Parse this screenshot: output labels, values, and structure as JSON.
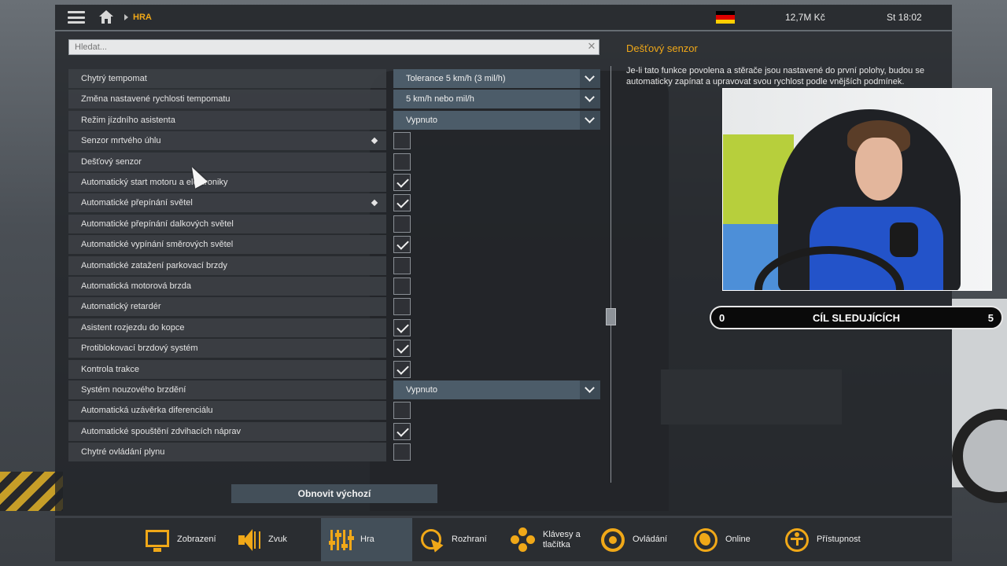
{
  "topbar": {
    "breadcrumb": "HRA",
    "money": "12,7M Kč",
    "clock": "St 18:02",
    "flag_colors": [
      "#000000",
      "#dd0000",
      "#ffce00"
    ]
  },
  "search": {
    "placeholder": "Hledat..."
  },
  "settings": [
    {
      "label": "Chytrý tempomat",
      "control": "select",
      "value": "Tolerance 5 km/h (3 mil/h)"
    },
    {
      "label": "Změna nastavené rychlosti tempomatu",
      "control": "select",
      "value": "5 km/h nebo mil/h"
    },
    {
      "label": "Režim jízdního asistenta",
      "control": "select",
      "value": "Vypnuto"
    },
    {
      "label": "Senzor mrtvého úhlu",
      "control": "checkbox",
      "checked": false,
      "marker": true
    },
    {
      "label": "Dešťový senzor",
      "control": "checkbox",
      "checked": false
    },
    {
      "label": "Automatický start motoru a elektroniky",
      "control": "checkbox",
      "checked": true
    },
    {
      "label": "Automatické přepínání světel",
      "control": "checkbox",
      "checked": true,
      "marker": true
    },
    {
      "label": "Automatické přepínání dalkových světel",
      "control": "checkbox",
      "checked": false
    },
    {
      "label": "Automatické vypínání směrových světel",
      "control": "checkbox",
      "checked": true
    },
    {
      "label": "Automatické zatažení parkovací brzdy",
      "control": "checkbox",
      "checked": false
    },
    {
      "label": "Automatická motorová brzda",
      "control": "checkbox",
      "checked": false
    },
    {
      "label": "Automatický retardér",
      "control": "checkbox",
      "checked": false
    },
    {
      "label": "Asistent rozjezdu do kopce",
      "control": "checkbox",
      "checked": true
    },
    {
      "label": "Protiblokovací brzdový systém",
      "control": "checkbox",
      "checked": true
    },
    {
      "label": "Kontrola trakce",
      "control": "checkbox",
      "checked": true
    },
    {
      "label": "Systém nouzového brzdění",
      "control": "select",
      "value": "Vypnuto"
    },
    {
      "label": "Automatická uzávěrka diferenciálu",
      "control": "checkbox",
      "checked": false
    },
    {
      "label": "Automatické spouštění zdvihacích náprav",
      "control": "checkbox",
      "checked": true
    },
    {
      "label": "Chytré ovládání plynu",
      "control": "checkbox",
      "checked": false
    }
  ],
  "reset_button": "Obnovit výchozí",
  "description": {
    "title": "Dešťový senzor",
    "text": "Je-li tato funkce povolena a stěrače jsou nastavené do první polohy, budou se automaticky zapínat a upravovat svou rychlost podle vnějších podmínek."
  },
  "goal_bar": {
    "min": "0",
    "label": "CÍL SLEDUJÍCÍCH",
    "max": "5"
  },
  "nav": [
    {
      "label": "Zobrazení",
      "icon": "display-icon",
      "active": false
    },
    {
      "label": "Zvuk",
      "icon": "sound-icon",
      "active": false
    },
    {
      "label": "Hra",
      "icon": "game-sliders-icon",
      "active": true
    },
    {
      "label": "Rozhraní",
      "icon": "interface-icon",
      "active": false
    },
    {
      "label": "Klávesy a tlačítka",
      "icon": "keys-buttons-icon",
      "active": false
    },
    {
      "label": "Ovládání",
      "icon": "steering-wheel-icon",
      "active": false
    },
    {
      "label": "Online",
      "icon": "globe-icon",
      "active": false
    },
    {
      "label": "Přístupnost",
      "icon": "accessibility-icon",
      "active": false
    }
  ],
  "accent_color": "#f0a818"
}
